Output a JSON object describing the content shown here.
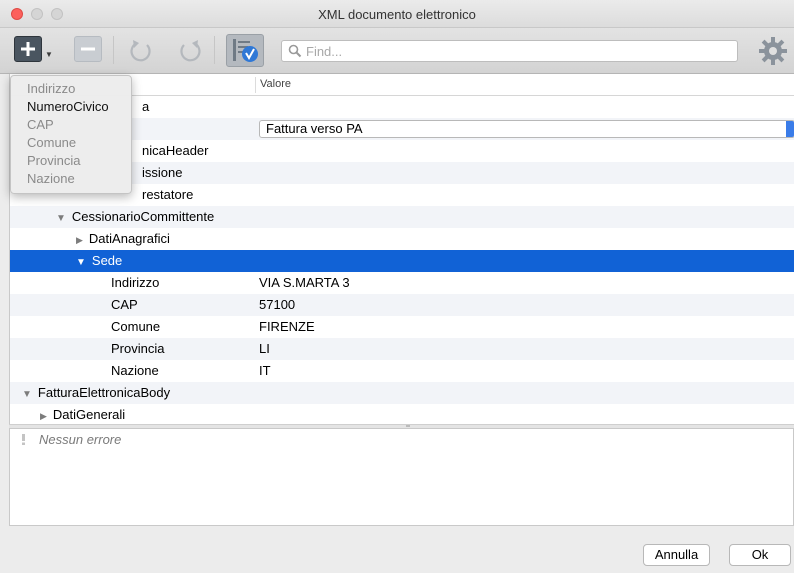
{
  "window": {
    "title": "XML documento elettronico"
  },
  "toolbar": {
    "search_placeholder": "Find..."
  },
  "tree": {
    "column_value_header": "Valore",
    "rows": [
      {
        "label": "a",
        "value": ""
      },
      {
        "label": "",
        "value": "Fattura verso PA"
      },
      {
        "label": "nicaHeader",
        "value": ""
      },
      {
        "label": "issione",
        "value": ""
      },
      {
        "label": "restatore",
        "value": ""
      },
      {
        "label": "CessionarioCommittente",
        "value": ""
      },
      {
        "label": "DatiAnagrafici",
        "value": ""
      },
      {
        "label": "Sede",
        "value": ""
      },
      {
        "label": "Indirizzo",
        "value": "VIA S.MARTA 3"
      },
      {
        "label": "CAP",
        "value": "57100"
      },
      {
        "label": "Comune",
        "value": "FIRENZE"
      },
      {
        "label": "Provincia",
        "value": "LI"
      },
      {
        "label": "Nazione",
        "value": "IT"
      },
      {
        "label": "FatturaElettronicaBody",
        "value": ""
      },
      {
        "label": "DatiGenerali",
        "value": ""
      }
    ]
  },
  "errors": {
    "message": "Nessun errore"
  },
  "buttons": {
    "cancel": "Annulla",
    "ok": "Ok"
  },
  "add_menu": {
    "items": [
      {
        "label": "Indirizzo",
        "enabled": false
      },
      {
        "label": "NumeroCivico",
        "enabled": true
      },
      {
        "label": "CAP",
        "enabled": false
      },
      {
        "label": "Comune",
        "enabled": false
      },
      {
        "label": "Provincia",
        "enabled": false
      },
      {
        "label": "Nazione",
        "enabled": false
      }
    ]
  },
  "colors": {
    "selection": "#1162d6",
    "close": "#fc605c",
    "accent": "#3a7ce8"
  },
  "icons": [
    "plus-icon",
    "minus-icon",
    "undo-icon",
    "redo-icon",
    "validate-icon",
    "search-icon",
    "gear-icon",
    "warning-icon"
  ]
}
